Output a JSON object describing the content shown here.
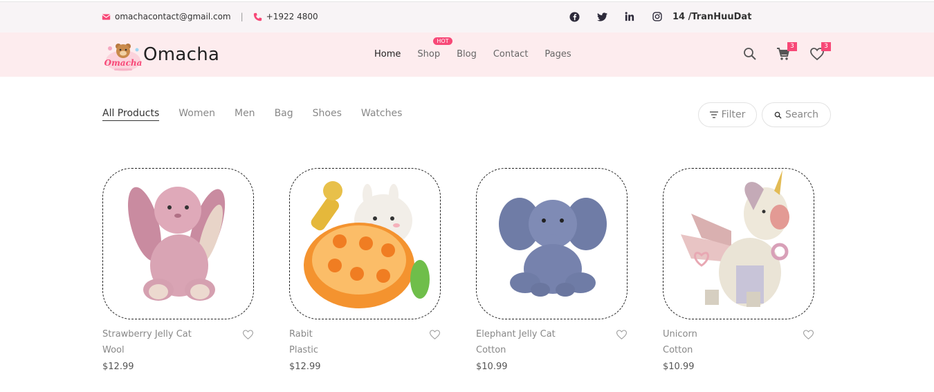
{
  "topbar": {
    "email": "omachacontact@gmail.com",
    "separator": "|",
    "phone": "+1922 4800",
    "user": "14 /TranHuuDat",
    "social_icons": [
      "facebook-icon",
      "twitter-icon",
      "linkedin-icon",
      "instagram-icon"
    ]
  },
  "header": {
    "logo_text": "Omacha",
    "nav": [
      {
        "label": "Home",
        "active": true
      },
      {
        "label": "Shop",
        "badge": "HOT"
      },
      {
        "label": "Blog"
      },
      {
        "label": "Contact"
      },
      {
        "label": "Pages"
      }
    ],
    "cart_count": "3",
    "wishlist_count": "3"
  },
  "filters": {
    "categories": [
      "All Products",
      "Women",
      "Men",
      "Bag",
      "Shoes",
      "Watches"
    ],
    "filter_label": "Filter",
    "search_label": "Search"
  },
  "products": [
    {
      "name": "Strawberry Jelly Cat",
      "material": "Wool",
      "price": "$12.99"
    },
    {
      "name": "Rabit",
      "material": "Plastic",
      "price": "$12.99"
    },
    {
      "name": "Elephant Jelly Cat",
      "material": "Cotton",
      "price": "$10.99"
    },
    {
      "name": "Unicorn",
      "material": "Cotton",
      "price": "$10.99"
    }
  ],
  "colors": {
    "accent": "#f74877",
    "header_bg": "#fdecee",
    "topbar_bg": "#f8f4f6"
  }
}
